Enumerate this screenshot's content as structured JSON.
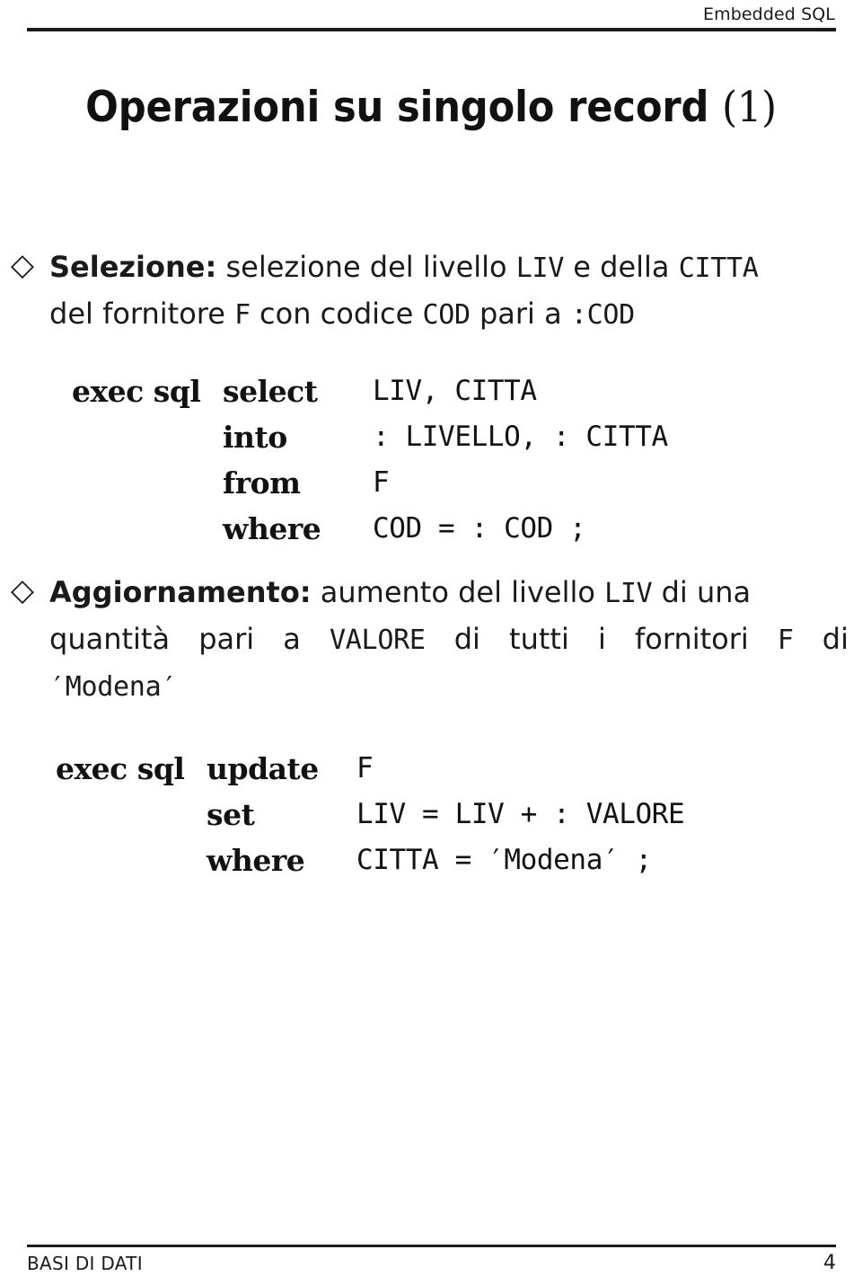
{
  "header": {
    "title": "Embedded SQL"
  },
  "title": {
    "main": "Operazioni su singolo record",
    "suffix": "(1)"
  },
  "bullets": [
    {
      "marker": "◇",
      "lead": "Selezione:",
      "line1_rest_a": " selezione del livello ",
      "line1_code_a": "LIV",
      "line1_rest_b": " e della ",
      "line1_code_b": "CITTA",
      "line2_a": "del fornitore ",
      "line2_code_a": "F",
      "line2_b": " con codice ",
      "line2_code_b": "COD",
      "line2_c": " pari a ",
      "line2_code_c": ":COD"
    },
    {
      "marker": "◇",
      "lead": "Aggiornamento:",
      "line1_rest_a": " aumento del livello ",
      "line1_code_a": "LIV",
      "line1_rest_b": " di una",
      "line2_a": "quantità pari a ",
      "line2_code_a": "VALORE",
      "line2_b": " di tutti i fornitori ",
      "line2_code_b": "F",
      "line2_c": " di",
      "line3_code": "′Modena′"
    }
  ],
  "sql_blocks": [
    {
      "exec": "exec sql",
      "rows": [
        {
          "keyword": "select",
          "value": "LIV, CITTA"
        },
        {
          "keyword": "into",
          "value": ": LIVELLO, : CITTA"
        },
        {
          "keyword": "from",
          "value": "F"
        },
        {
          "keyword": "where",
          "value": "COD = : COD ;"
        }
      ]
    },
    {
      "exec": "exec sql",
      "rows": [
        {
          "keyword": "update",
          "value": "F"
        },
        {
          "keyword": "set",
          "value": "LIV = LIV + : VALORE"
        },
        {
          "keyword": "where",
          "value": "CITTA = ′Modena′ ;"
        }
      ]
    }
  ],
  "footer": {
    "left": "BASI DI DATI",
    "page": "4"
  }
}
